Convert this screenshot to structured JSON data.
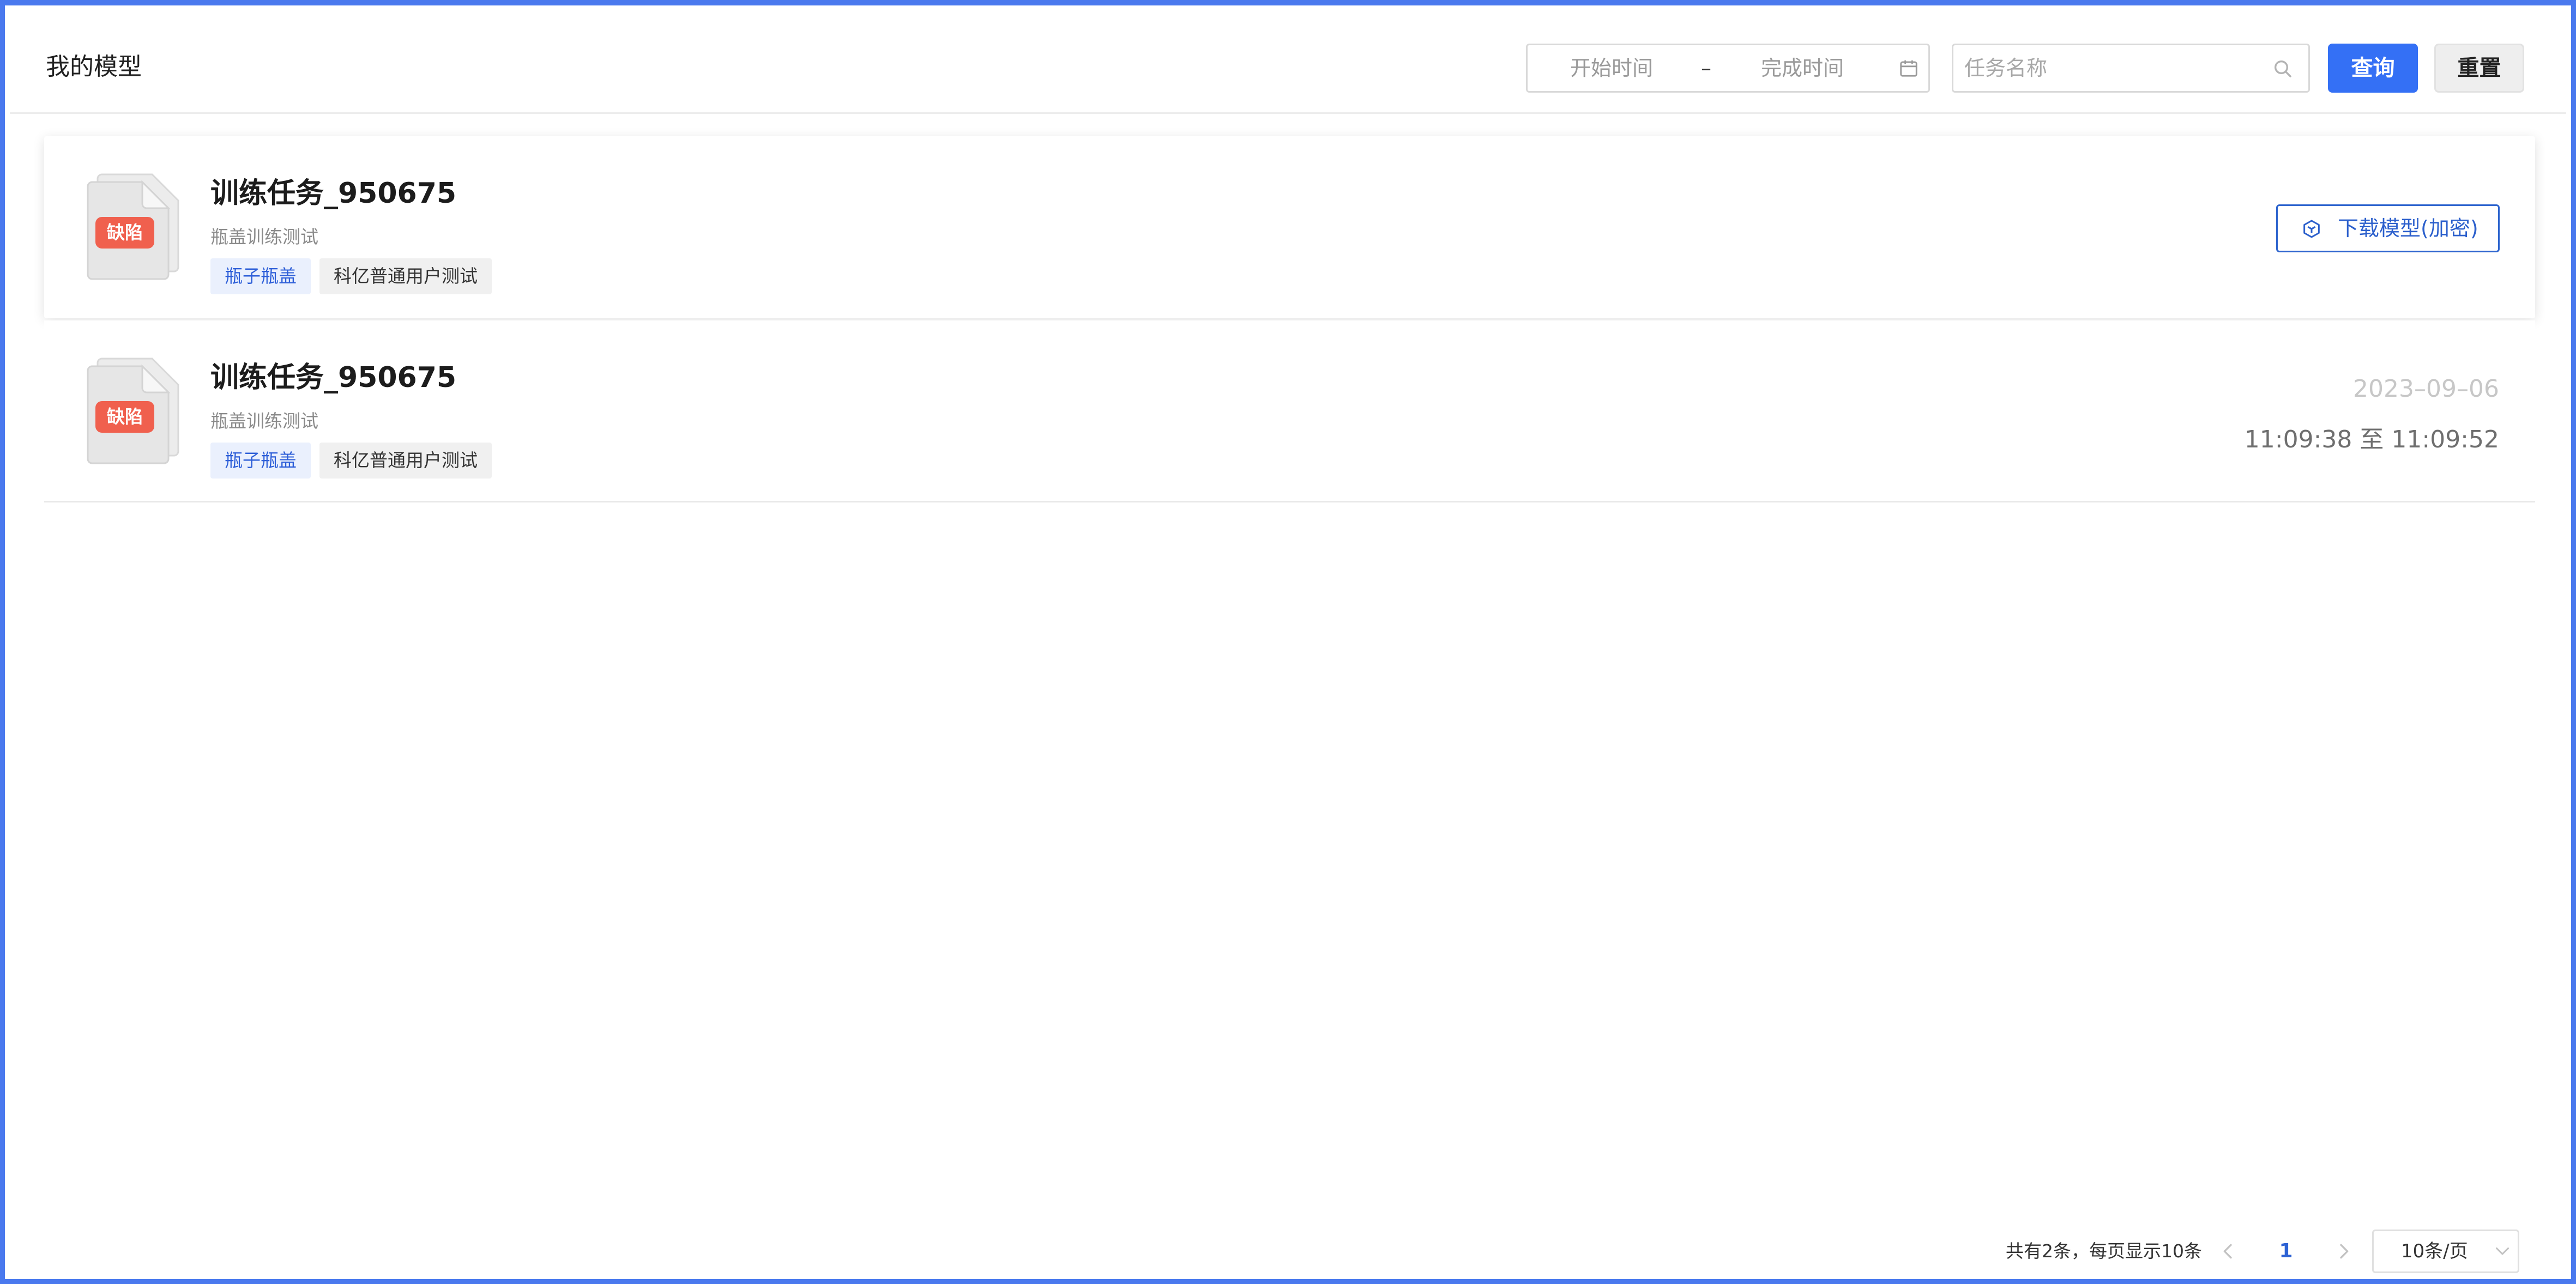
{
  "header": {
    "title": "我的模型",
    "date_start_placeholder": "开始时间",
    "date_separator": "–",
    "date_end_placeholder": "完成时间",
    "search_placeholder": "任务名称",
    "query_label": "查询",
    "reset_label": "重置"
  },
  "cards": [
    {
      "badge": "缺陷",
      "title": "训练任务_950675",
      "description": "瓶盖训练测试",
      "tags": [
        "瓶子瓶盖",
        "科亿普通用户测试"
      ],
      "download_label": "下载模型(加密)"
    },
    {
      "badge": "缺陷",
      "title": "训练任务_950675",
      "description": "瓶盖训练测试",
      "tags": [
        "瓶子瓶盖",
        "科亿普通用户测试"
      ],
      "date": "2023–09–06",
      "time_range": "11:09:38 至 11:09:52"
    }
  ],
  "pagination": {
    "total_text": "共有2条，每页显示10条",
    "current_page": "1",
    "page_size_label": "10条/页"
  },
  "colors": {
    "primary": "#3470f5",
    "badge_red": "#f0604e",
    "frame_blue": "#4a79ee",
    "tag_blue_bg": "#eaf0fd"
  },
  "icons": {
    "calendar": "calendar-icon",
    "search": "search-icon",
    "download": "cube-icon",
    "prev": "chevron-left-icon",
    "next": "chevron-right-icon",
    "dropdown": "chevron-down-icon"
  }
}
